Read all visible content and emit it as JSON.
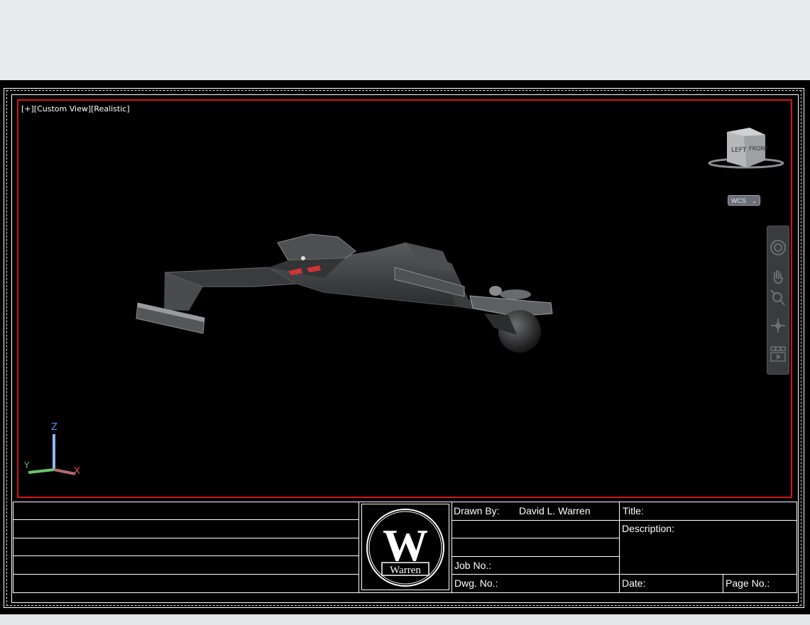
{
  "viewport": {
    "label": "[+][Custom View][Realistic]"
  },
  "viewcube": {
    "left_face": "LEFT",
    "front_face": "FRONT"
  },
  "wcs": {
    "label": "WCS"
  },
  "navbar": {
    "items": [
      "full-navigation-wheel",
      "pan",
      "zoom-extents",
      "orbit",
      "showmotion"
    ]
  },
  "ucs": {
    "x_label": "X",
    "y_label": "Y",
    "z_label": "Z"
  },
  "title_block": {
    "drawn_by_label": "Drawn By:",
    "drawn_by_value": "David L. Warren",
    "job_no_label": "Job No.:",
    "dwg_no_label": "Dwg. No.:",
    "title_label": "Title:",
    "description_label": "Description:",
    "date_label": "Date:",
    "page_no_label": "Page No.:",
    "logo_text": "Warren",
    "logo_letter": "W"
  },
  "colors": {
    "viewport_border": "#d3141a",
    "background": "#000000",
    "ucs_x": "#e05050",
    "ucs_y": "#58c058",
    "ucs_z": "#5a8ff0"
  }
}
